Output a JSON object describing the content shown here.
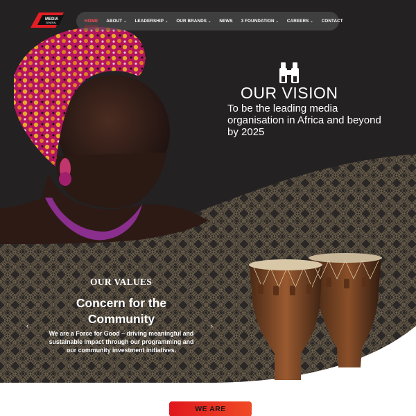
{
  "logo": {
    "line1": "MEDIA",
    "line2": "GENERAL"
  },
  "nav": {
    "items": [
      {
        "label": "HOME",
        "chevron": false
      },
      {
        "label": "ABOUT",
        "chevron": true
      },
      {
        "label": "LEADERSHIP",
        "chevron": true
      },
      {
        "label": "OUR BRANDS",
        "chevron": true
      },
      {
        "label": "NEWS",
        "chevron": false
      },
      {
        "label": "3 FOUNDATION",
        "chevron": true
      },
      {
        "label": "CAREERS",
        "chevron": true
      },
      {
        "label": "CONTACT",
        "chevron": false
      }
    ],
    "chevron_glyph": "⌄"
  },
  "vision": {
    "icon": "binoculars-icon",
    "title": "OUR VISION",
    "text": "To be the leading media organisation in Africa and beyond by 2025"
  },
  "values": {
    "heading": "OUR VALUES",
    "title": "Concern for the Community",
    "text": "We are a Force for Good – driving meaningful and sustainable impact through our programming and our community investment initiatives.",
    "prev_glyph": "‹",
    "next_glyph": "›"
  },
  "we_are": {
    "label": "WE ARE"
  },
  "colors": {
    "accent": "#e31e24",
    "dark": "#232122",
    "pattern_gold": "#8a7a5c"
  }
}
